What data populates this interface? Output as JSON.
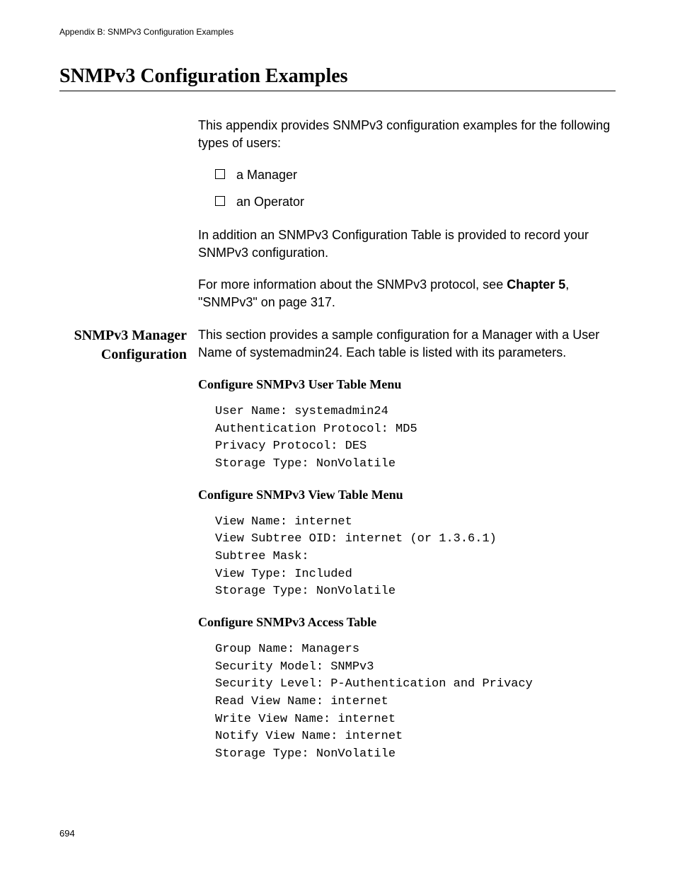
{
  "runningHeader": "Appendix B: SNMPv3 Configuration Examples",
  "mainHeading": "SNMPv3 Configuration Examples",
  "intro": "This appendix provides SNMPv3 configuration examples for the following types of users:",
  "bullets": [
    "a Manager",
    "an Operator"
  ],
  "paraAfterBullets": "In addition an SNMPv3 Configuration Table is provided to record your SNMPv3 configuration.",
  "paraMoreInfoPre": "For more information about the SNMPv3 protocol, see ",
  "paraMoreInfoBold": "Chapter 5",
  "paraMoreInfoPost": ", \"SNMPv3\" on page 317.",
  "sidebarHeading": "SNMPv3 Manager Configuration",
  "sectionIntro": "This section provides a sample configuration for a Manager with a User Name of systemadmin24. Each table is listed with its parameters.",
  "sub1": "Configure SNMPv3 User Table Menu",
  "code1": "User Name: systemadmin24\nAuthentication Protocol: MD5\nPrivacy Protocol: DES\nStorage Type: NonVolatile",
  "sub2": "Configure SNMPv3 View Table Menu",
  "code2": "View Name: internet\nView Subtree OID: internet (or 1.3.6.1)\nSubtree Mask:\nView Type: Included\nStorage Type: NonVolatile",
  "sub3": "Configure SNMPv3 Access Table",
  "code3": "Group Name: Managers\nSecurity Model: SNMPv3\nSecurity Level: P-Authentication and Privacy\nRead View Name: internet\nWrite View Name: internet\nNotify View Name: internet\nStorage Type: NonVolatile",
  "pageNumber": "694"
}
